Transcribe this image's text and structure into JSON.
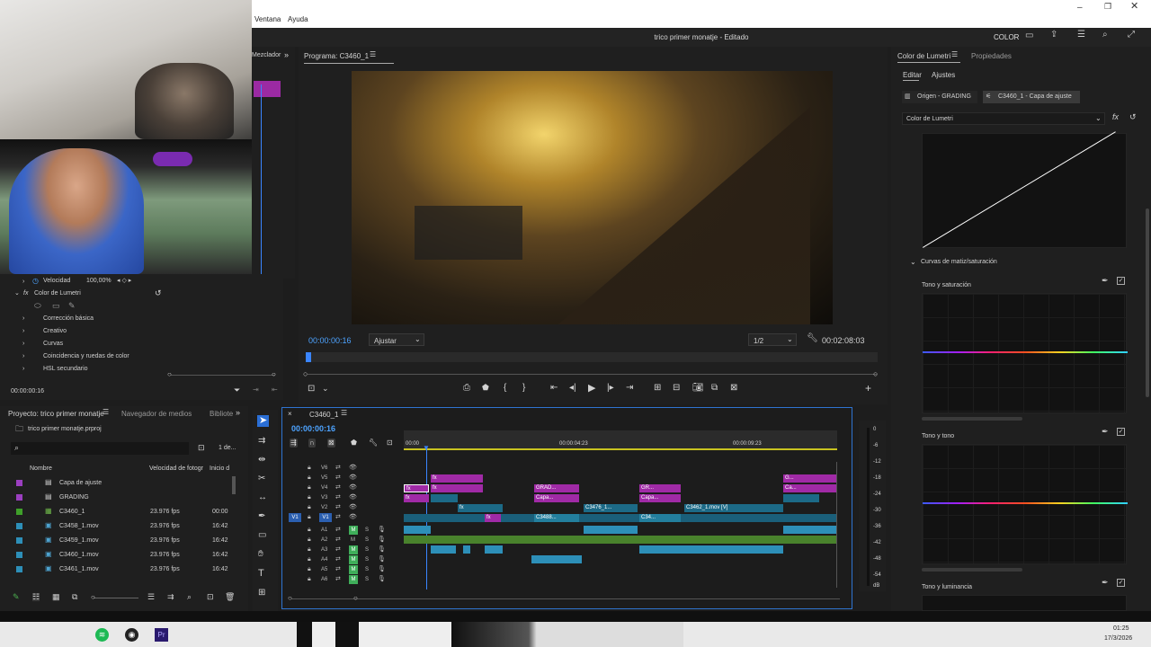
{
  "menu": {
    "items": [
      "Ventana",
      "Ayuda"
    ]
  },
  "window": {
    "title": "trico primer monatje - Editado",
    "workspace": "COLOR"
  },
  "effect_controls": {
    "tab_partial": "Mezclador",
    "velocidad_label": "Velocidad",
    "velocidad_value": "100,00%",
    "lumetri_label": "Color de Lumetri",
    "sections": [
      "Corrección básica",
      "Creativo",
      "Curvas",
      "Coincidencia y ruedas de color",
      "HSL secundario"
    ],
    "timecode": "00:00:00:16"
  },
  "program": {
    "tab": "Programa: C3460_1",
    "timecode": "00:00:00:16",
    "fit": "Ajustar",
    "resolution": "1/2",
    "duration": "00:02:08:03"
  },
  "project": {
    "tabs": [
      "Proyecto: trico primer monatje",
      "Navegador de medios",
      "Bibliote"
    ],
    "file": "trico primer monatje.prproj",
    "count": "1 de...",
    "search_placeholder": "",
    "columns": [
      "Nombre",
      "Velocidad de fotogr",
      "Inicio d"
    ],
    "rows": [
      {
        "name": "Capa de ajuste",
        "fps": "",
        "start": "",
        "color": "#9b3fc0"
      },
      {
        "name": "GRADING",
        "fps": "",
        "start": "",
        "color": "#9b3fc0"
      },
      {
        "name": "C3460_1",
        "fps": "23.976 fps",
        "start": "00:00",
        "color": "#3fa02a"
      },
      {
        "name": "C3458_1.mov",
        "fps": "23.976 fps",
        "start": "16:42",
        "color": "#2d8fb8"
      },
      {
        "name": "C3459_1.mov",
        "fps": "23.976 fps",
        "start": "16:42",
        "color": "#2d8fb8"
      },
      {
        "name": "C3460_1.mov",
        "fps": "23.976 fps",
        "start": "16:42",
        "color": "#2d8fb8"
      },
      {
        "name": "C3461_1.mov",
        "fps": "23.976 fps",
        "start": "16:42",
        "color": "#2d8fb8"
      }
    ]
  },
  "timeline": {
    "tab": "C3460_1",
    "timecode": "00:00:00:16",
    "ruler": [
      "00:00",
      "00:00:04:23",
      "00:00:09:23"
    ],
    "video_tracks": [
      "V6",
      "V5",
      "V4",
      "V3",
      "V2",
      "V1"
    ],
    "audio_tracks": [
      "A1",
      "A2",
      "A3",
      "A4",
      "A5",
      "A6"
    ],
    "clips": {
      "fx": "fx",
      "grad": "GRAD...",
      "capa": "Capa...",
      "gr": "GR...",
      "capa2": "Capa...",
      "c3476": "C3476_1...",
      "c3462": "C3462_1.mov [V]",
      "c3488": "C3488...",
      "c34": "C34...",
      "g": "G...",
      "ca": "Ca..."
    },
    "meter": [
      "0",
      "-6",
      "-12",
      "-18",
      "-24",
      "-30",
      "-36",
      "-42",
      "-48",
      "-54",
      "dB"
    ]
  },
  "lumetri": {
    "tabs": [
      "Color de Lumetri",
      "Propiedades"
    ],
    "subtabs": [
      "Editar",
      "Ajustes"
    ],
    "source": "Origen - GRADING",
    "target": "C3460_1 - Capa de ajuste",
    "effect": "Color de Lumetri",
    "section": "Curvas de matiz/saturación",
    "curve_labels": [
      "Tono y saturación",
      "Tono y tono",
      "Tono y luminancia"
    ]
  },
  "taskbar": {
    "time": "01:25",
    "date": "17/3/2026"
  }
}
